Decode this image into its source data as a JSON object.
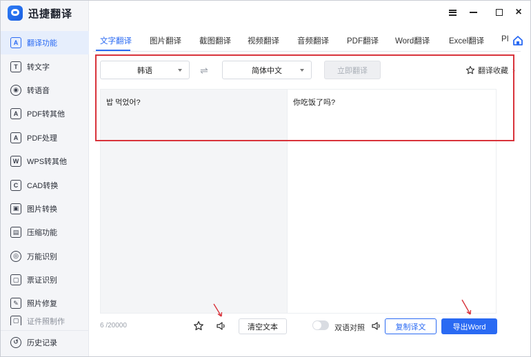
{
  "app": {
    "title": "迅捷翻译"
  },
  "sidebar": {
    "items": [
      {
        "label": "翻译功能",
        "icon": "translate-a-icon",
        "glyph": "A",
        "active": true
      },
      {
        "label": "转文字",
        "icon": "text-convert-icon",
        "glyph": "T"
      },
      {
        "label": "转语音",
        "icon": "voice-convert-icon",
        "glyph": "◉"
      },
      {
        "label": "PDF转其他",
        "icon": "pdf-convert-icon",
        "glyph": "A"
      },
      {
        "label": "PDF处理",
        "icon": "pdf-process-icon",
        "glyph": "A"
      },
      {
        "label": "WPS转其他",
        "icon": "wps-convert-icon",
        "glyph": "W"
      },
      {
        "label": "CAD转换",
        "icon": "cad-convert-icon",
        "glyph": "C"
      },
      {
        "label": "图片转换",
        "icon": "image-convert-icon",
        "glyph": "▣"
      },
      {
        "label": "压缩功能",
        "icon": "compress-icon",
        "glyph": "▤"
      },
      {
        "label": "万能识别",
        "icon": "ocr-icon",
        "glyph": "◎"
      },
      {
        "label": "票证识别",
        "icon": "ticket-recognize-icon",
        "glyph": "▢"
      },
      {
        "label": "照片修复",
        "icon": "photo-repair-icon",
        "glyph": "✎"
      },
      {
        "label": "证件照制作",
        "icon": "id-photo-icon",
        "glyph": "▢"
      }
    ],
    "footer": {
      "label": "历史记录",
      "icon": "history-icon",
      "glyph": "↺"
    }
  },
  "tabs": [
    {
      "label": "文字翻译",
      "active": true
    },
    {
      "label": "图片翻译"
    },
    {
      "label": "截图翻译"
    },
    {
      "label": "视频翻译"
    },
    {
      "label": "音频翻译"
    },
    {
      "label": "PDF翻译"
    },
    {
      "label": "Word翻译"
    },
    {
      "label": "Excel翻译"
    },
    {
      "label": "PI"
    }
  ],
  "toolbar": {
    "source_language": "韩语",
    "target_language": "简体中文",
    "swap_icon": "⇌",
    "translate_label": "立即翻译",
    "favorites_label": "翻译收藏",
    "favorites_chevron": "›"
  },
  "editor": {
    "source_text": "밥 먹었어?",
    "target_text": "你吃饭了吗?"
  },
  "footer": {
    "char_count": "6 /20000",
    "clear_label": "清空文本",
    "bilingual_label": "双语对照",
    "bilingual_on": false,
    "copy_label": "复制译文",
    "export_label": "导出Word"
  },
  "colors": {
    "accent": "#2a6af3",
    "annotation": "#d8323a",
    "sidebar_bg": "#f4f5f8"
  }
}
